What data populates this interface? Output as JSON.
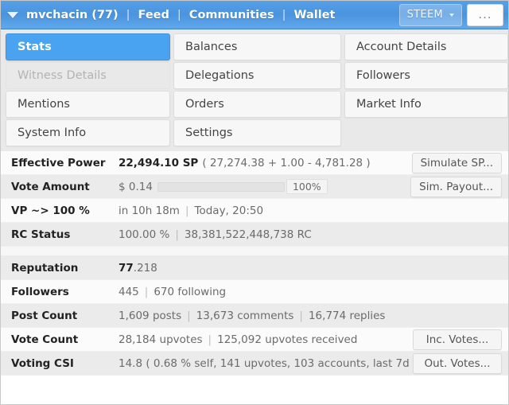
{
  "header": {
    "caret_icon": "caret-down-icon",
    "account": "mvchacin (77)",
    "nav": [
      "Feed",
      "Communities",
      "Wallet"
    ],
    "separator": "|",
    "currency_select": "STEEM",
    "currency_caret_icon": "caret-down-icon",
    "more_label": "..."
  },
  "tabs": [
    {
      "label": "Stats",
      "state": "active"
    },
    {
      "label": "Balances",
      "state": "normal"
    },
    {
      "label": "Account Details",
      "state": "normal"
    },
    {
      "label": "Witness Details",
      "state": "disabled"
    },
    {
      "label": "Delegations",
      "state": "normal"
    },
    {
      "label": "Followers",
      "state": "normal"
    },
    {
      "label": "Mentions",
      "state": "normal"
    },
    {
      "label": "Orders",
      "state": "normal"
    },
    {
      "label": "Market Info",
      "state": "normal"
    },
    {
      "label": "System Info",
      "state": "normal"
    },
    {
      "label": "Settings",
      "state": "normal"
    },
    {
      "label": "",
      "state": "empty"
    }
  ],
  "stats": {
    "effective_power": {
      "label": "Effective Power",
      "value_strong": "22,494.10 SP",
      "value_rest": "( 27,274.38 + 1.00 - 4,781.28 )",
      "button": "Simulate SP..."
    },
    "vote_amount": {
      "label": "Vote Amount",
      "value": "$ 0.14",
      "progress_percent": 100,
      "progress_label": "100%",
      "button": "Sim. Payout..."
    },
    "vp_to_100": {
      "label": "VP ~> 100 %",
      "time_remaining": "in 10h 18m",
      "eta": "Today, 20:50"
    },
    "rc_status": {
      "label": "RC Status",
      "percent": "100.00 %",
      "amount": "38,381,522,448,738 RC"
    },
    "reputation": {
      "label": "Reputation",
      "value_strong": "77",
      "value_rest": ".218"
    },
    "followers": {
      "label": "Followers",
      "count": "445",
      "following": "670 following"
    },
    "post_count": {
      "label": "Post Count",
      "posts": "1,609 posts",
      "comments": "13,673 comments",
      "replies": "16,774 replies"
    },
    "vote_count": {
      "label": "Vote Count",
      "upvotes": "28,184 upvotes",
      "received": "125,092 upvotes received",
      "button": "Inc. Votes..."
    },
    "voting_csi": {
      "label": "Voting CSI",
      "value": "14.8 ( 0.68 % self, 141 upvotes, 103 accounts, last 7d )",
      "button": "Out. Votes..."
    }
  },
  "colors": {
    "header_blue": "#4a93de",
    "active_tab_blue": "#4aa3f0",
    "row_alt_gray": "#ebebeb",
    "tabgrid_bg": "#e9e9e9"
  }
}
